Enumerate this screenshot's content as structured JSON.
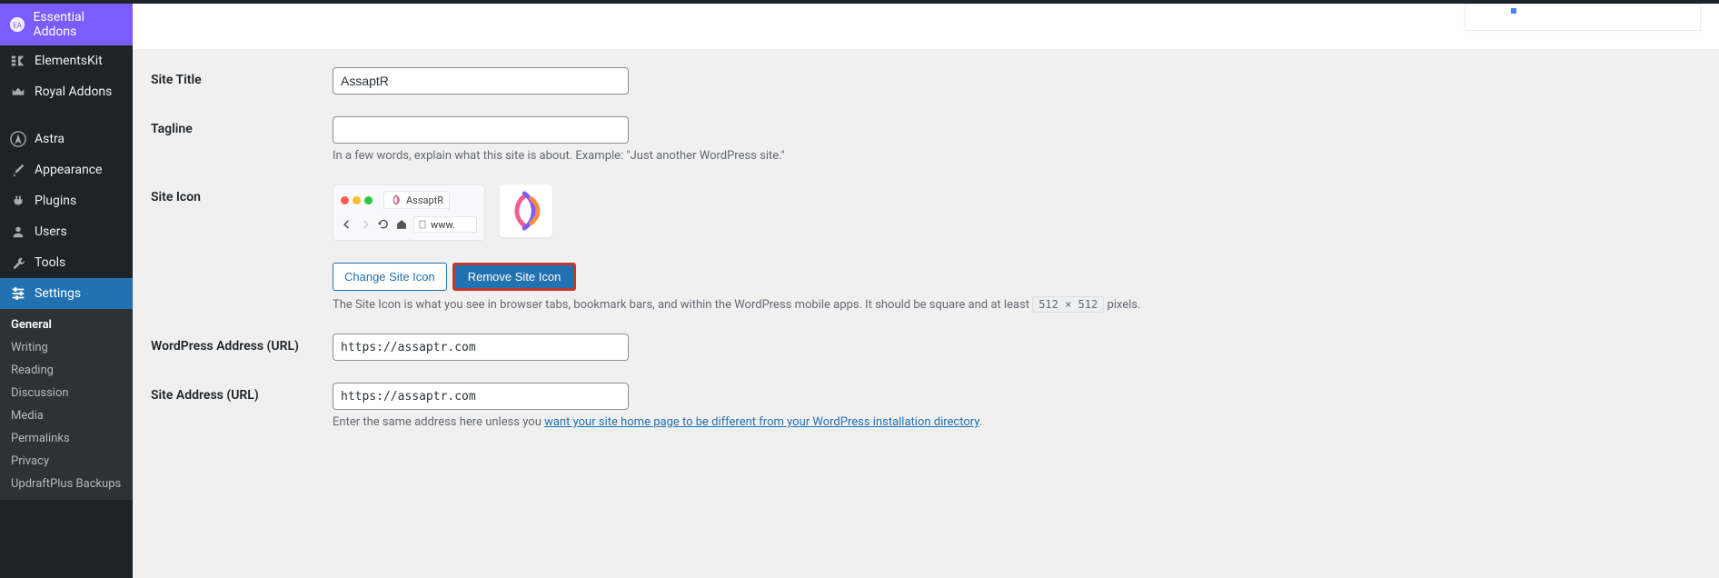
{
  "sidebar": {
    "items": [
      {
        "label": "Essential Addons",
        "icon": "ea"
      },
      {
        "label": "ElementsKit",
        "icon": "ek"
      },
      {
        "label": "Royal Addons",
        "icon": "crown"
      },
      {
        "label": "Astra",
        "icon": "astra"
      },
      {
        "label": "Appearance",
        "icon": "brush"
      },
      {
        "label": "Plugins",
        "icon": "plug"
      },
      {
        "label": "Users",
        "icon": "users"
      },
      {
        "label": "Tools",
        "icon": "wrench"
      },
      {
        "label": "Settings",
        "icon": "sliders"
      }
    ],
    "submenu": [
      {
        "label": "General"
      },
      {
        "label": "Writing"
      },
      {
        "label": "Reading"
      },
      {
        "label": "Discussion"
      },
      {
        "label": "Media"
      },
      {
        "label": "Permalinks"
      },
      {
        "label": "Privacy"
      },
      {
        "label": "UpdraftPlus Backups"
      }
    ]
  },
  "form": {
    "siteTitle": {
      "label": "Site Title",
      "value": "AssaptR"
    },
    "tagline": {
      "label": "Tagline",
      "value": "",
      "description": "In a few words, explain what this site is about. Example: \"Just another WordPress site.\""
    },
    "siteIcon": {
      "label": "Site Icon",
      "tabName": "AssaptR",
      "urlText": "www.",
      "changeButton": "Change Site Icon",
      "removeButton": "Remove Site Icon",
      "description1": "The Site Icon is what you see in browser tabs, bookmark bars, and within the WordPress mobile apps. It should be square and at least ",
      "sizeCode": "512 × 512",
      "description2": " pixels."
    },
    "wpAddress": {
      "label": "WordPress Address (URL)",
      "value": "https://assaptr.com"
    },
    "siteAddress": {
      "label": "Site Address (URL)",
      "value": "https://assaptr.com",
      "description1": "Enter the same address here unless you ",
      "linkText": "want your site home page to be different from your WordPress installation directory",
      "description2": "."
    }
  }
}
